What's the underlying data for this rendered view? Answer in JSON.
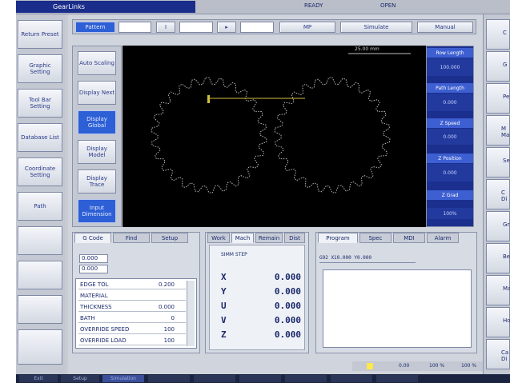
{
  "window": {
    "title": "GearLinks"
  },
  "title_bar": {
    "center_left": "READY",
    "center_right": "OPEN"
  },
  "toolbar": {
    "button1": "Pattern",
    "mid1": "MP",
    "mid2": "Simulate",
    "right": "Manual"
  },
  "left_menu": [
    {
      "label": "Return Preset"
    },
    {
      "label": "Graphic Setting"
    },
    {
      "label": "Tool Bar Setting"
    },
    {
      "label": "Database List"
    },
    {
      "label": "Coordinate Setting"
    },
    {
      "label": "Path"
    },
    {
      "label": ""
    },
    {
      "label": ""
    },
    {
      "label": ""
    },
    {
      "label": ""
    }
  ],
  "view_buttons": [
    {
      "label": "Auto Scaling"
    },
    {
      "label": "Display Next"
    },
    {
      "label": "Display Global"
    },
    {
      "label": "Display Model"
    },
    {
      "label": "Display Trace"
    },
    {
      "label": "Input Dimension"
    }
  ],
  "canvas": {
    "scale_label": "25.00 mm"
  },
  "right_info": [
    {
      "label": "Row Length",
      "value": "100.000"
    },
    {
      "label": "Path Length",
      "value": "0.000"
    },
    {
      "label": "Z Speed",
      "value": "0.000"
    },
    {
      "label": "Z Position",
      "value": "0.000"
    },
    {
      "label": "Z Grad",
      "value": "100%"
    }
  ],
  "left_panel": {
    "tabs": [
      "G Code",
      "Find",
      "Setup"
    ],
    "inputs": [
      "0.000",
      "0.000"
    ],
    "rows": [
      {
        "label": "EDGE TOL",
        "value": "0.200"
      },
      {
        "label": "MATERIAL",
        "value": ""
      },
      {
        "label": "THICKNESS",
        "value": "0.000"
      },
      {
        "label": "BATH",
        "value": "0"
      },
      {
        "label": "OVERRIDE SPEED",
        "value": "100"
      },
      {
        "label": "OVERRIDE LOAD",
        "value": "100"
      }
    ]
  },
  "mid_panel": {
    "tabs": [
      "Work",
      "Mach",
      "Remain",
      "Dist"
    ],
    "header": "SIMM STEP",
    "axes": [
      {
        "axis": "X",
        "value": "0.000"
      },
      {
        "axis": "Y",
        "value": "0.000"
      },
      {
        "axis": "U",
        "value": "0.000"
      },
      {
        "axis": "V",
        "value": "0.000"
      },
      {
        "axis": "Z",
        "value": "0.000"
      }
    ]
  },
  "right_panel": {
    "tabs": [
      "Program",
      "Spec",
      "MDI",
      "Alarm"
    ],
    "code_line": "G92 X10.000 Y0.000"
  },
  "far_right": [
    "C",
    "G",
    "Pe",
    "M Ma",
    "Se",
    "C Di",
    "Gr",
    "Be",
    "Ma",
    "Ho",
    "Ca Di"
  ],
  "status_bar": [
    "0.00",
    "100 %",
    "100 %"
  ],
  "bottom_bar": [
    "Exit",
    "Setup",
    "Simulation",
    "",
    "",
    "",
    "",
    "",
    ""
  ],
  "colors": {
    "canvas_bg": "#000000",
    "panel_blue": "#1a2d8a",
    "accent_blue": "#2d5fd6",
    "gear": "#b8b8b8",
    "trace": "#d6c13a",
    "status_yellow": "#ffe84a"
  }
}
